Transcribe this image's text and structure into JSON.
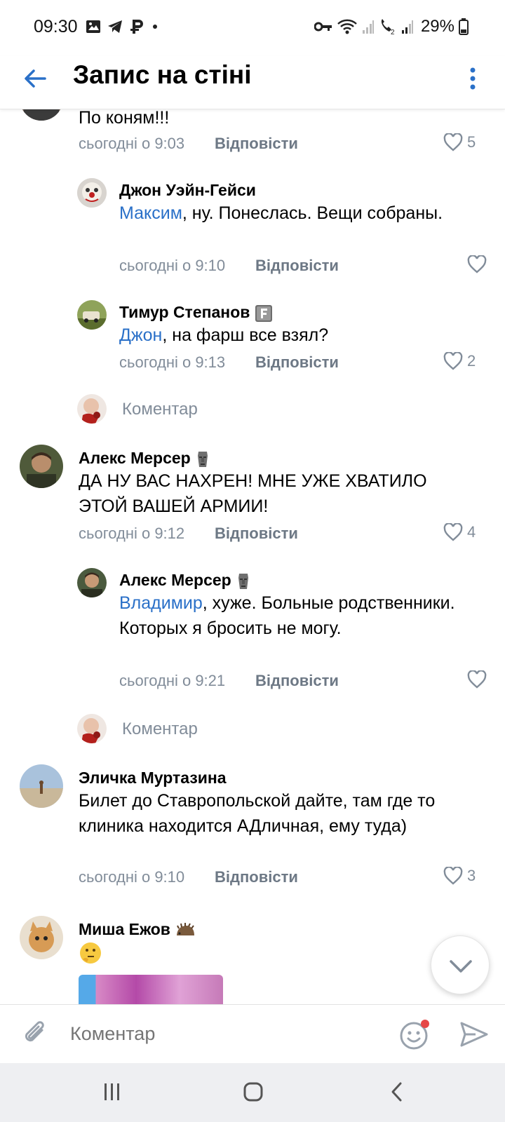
{
  "status_bar": {
    "time": "09:30",
    "battery": "29%",
    "sim_label": "2"
  },
  "header": {
    "title": "Запис на стіні"
  },
  "comments": [
    {
      "text": "По коням!!!",
      "time": "сьогодні о 9:03",
      "reply_label": "Відповісти",
      "likes": "5"
    },
    {
      "author": "Джон Уэйн-Гейси",
      "mention": "Максим",
      "text": ", ну. Понеслась. Вещи собраны.",
      "time": "сьогодні о 9:10",
      "reply_label": "Відповісти"
    },
    {
      "author": "Тимур Степанов",
      "mention": "Джон",
      "text": ", на фарш все взял?",
      "time": "сьогодні о 9:13",
      "reply_label": "Відповісти",
      "likes": "2"
    },
    {
      "author": "Алекс Мерсер",
      "text": "ДА НУ ВАС НАХРЕН! МНЕ УЖЕ ХВАТИЛО ЭТОЙ ВАШЕЙ АРМИИ!",
      "time": "сьогодні о 9:12",
      "reply_label": "Відповісти",
      "likes": "4"
    },
    {
      "author": "Алекс Мерсер",
      "mention": "Владимир",
      "text": ", хуже. Больные родственники. Которых я бросить не могу.",
      "time": "сьогодні о 9:21",
      "reply_label": "Відповісти"
    },
    {
      "author": "Эличка Муртазина",
      "text": "Билет до Ставропольской дайте, там где то клиника находится АДличная, ему туда)",
      "time": "сьогодні о 9:10",
      "reply_label": "Відповісти",
      "likes": "3"
    },
    {
      "author": "Миша Ежов"
    }
  ],
  "add_comment_label": "Коментар",
  "composer": {
    "placeholder": "Коментар"
  },
  "colors": {
    "accent": "#2a70c8",
    "meta": "#818c99",
    "notification_dot": "#e64646"
  }
}
